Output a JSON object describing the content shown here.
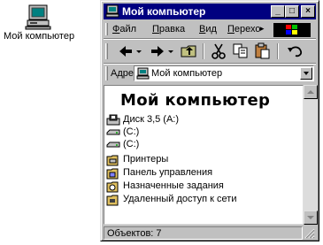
{
  "desktop": {
    "icon_label": "Мой компьютер",
    "icon_name": "my-computer-icon"
  },
  "window": {
    "title": "Мой компьютер",
    "controls": {
      "minimize": "_",
      "maximize": "□",
      "close": "×"
    },
    "titlebar_color": "#000080"
  },
  "menu": {
    "items": [
      {
        "label": "Файл",
        "underline": "Ф",
        "rest": "айл"
      },
      {
        "label": "Правка",
        "underline": "П",
        "rest": "равка"
      },
      {
        "label": "Вид",
        "underline": "В",
        "rest": "ид"
      },
      {
        "label": "Переход",
        "underline": "П",
        "rest": "ереход"
      }
    ],
    "overflow_glyph": "▸"
  },
  "toolbar": {
    "buttons": [
      "back-icon",
      "forward-icon",
      "up-folder-icon",
      "cut-icon",
      "copy-icon",
      "paste-icon",
      "undo-icon"
    ]
  },
  "address": {
    "label": "Адрес",
    "value": "Мой компьютер"
  },
  "content": {
    "heading": "Мой компьютер",
    "items": [
      {
        "label": "Диск 3,5 (A:)",
        "icon": "floppy-drive-icon"
      },
      {
        "label": "(C:)",
        "icon": "hard-drive-icon"
      },
      {
        "label": "(C:)",
        "icon": "hard-drive-icon"
      },
      {
        "label": "Принтеры",
        "icon": "printers-folder-icon"
      },
      {
        "label": "Панель управления",
        "icon": "control-panel-folder-icon"
      },
      {
        "label": "Назначенные задания",
        "icon": "scheduled-tasks-folder-icon"
      },
      {
        "label": "Удаленный доступ к сети",
        "icon": "dial-up-networking-folder-icon"
      }
    ]
  },
  "status": {
    "text": "Объектов: 7"
  }
}
